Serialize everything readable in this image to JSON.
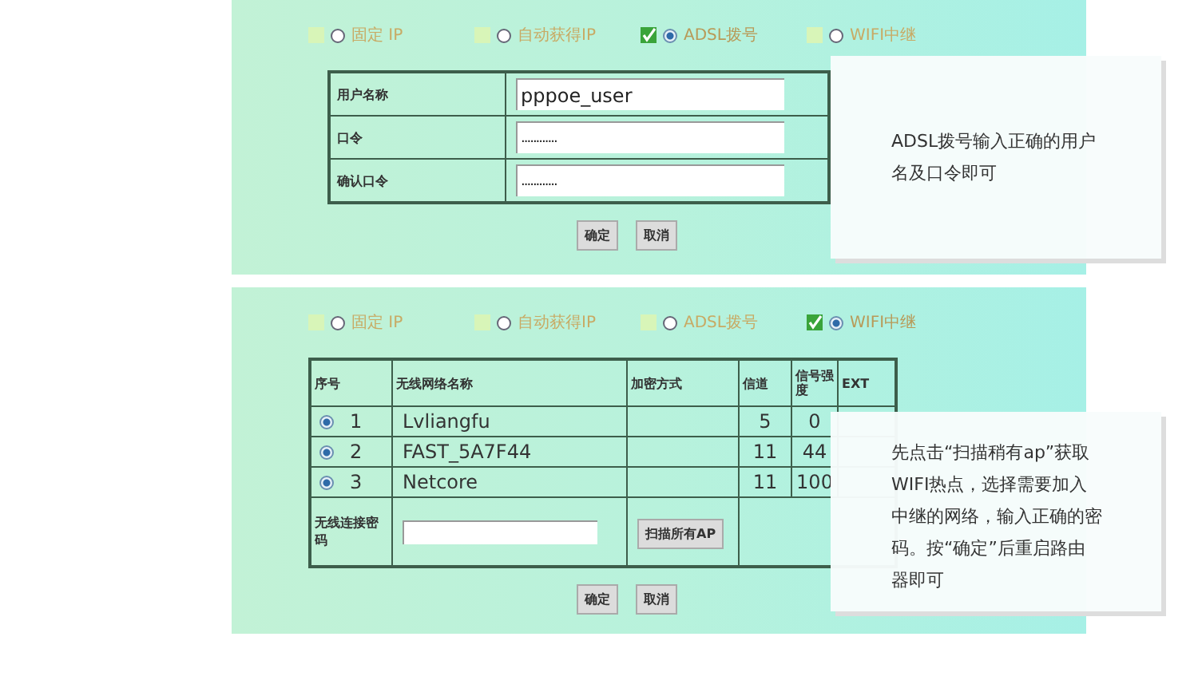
{
  "panels": [
    {
      "kind": "adsl",
      "modes": [
        {
          "label": "固定 IP",
          "selected": false
        },
        {
          "label": "自动获得IP",
          "selected": false
        },
        {
          "label": "ADSL拨号",
          "selected": true
        },
        {
          "label": "WIFI中继",
          "selected": false
        }
      ],
      "fields": [
        {
          "label": "用户名称",
          "value": "pppoe_user",
          "kind": "text"
        },
        {
          "label": "口令",
          "value": "............",
          "kind": "password"
        },
        {
          "label": "确认口令",
          "value": "............",
          "kind": "password"
        }
      ],
      "buttons": [
        "确定",
        "取消"
      ],
      "note": "ADSL拨号输入正确的用户名及口令即可"
    },
    {
      "kind": "wifi",
      "modes": [
        {
          "label": "固定 IP",
          "selected": false
        },
        {
          "label": "自动获得IP",
          "selected": false
        },
        {
          "label": "ADSL拨号",
          "selected": false
        },
        {
          "label": "WIFI中继",
          "selected": true
        }
      ],
      "table": {
        "columns": [
          "序号",
          "无线网络名称",
          "加密方式",
          "信道",
          "信号强度",
          "EXT"
        ],
        "rows": [
          {
            "index": "1",
            "ssid": "Lvliangfu",
            "channel": "5",
            "signal": "0",
            "selected": true
          },
          {
            "index": "2",
            "ssid": "FAST_5A7F44",
            "channel": "11",
            "signal": "44",
            "selected": true
          },
          {
            "index": "3",
            "ssid": "Netcore",
            "channel": "11",
            "signal": "100",
            "selected": true
          }
        ],
        "password_label": "无线连接密码",
        "scan_button": "扫描所有AP"
      },
      "buttons": [
        "确定",
        "取消"
      ],
      "note": "先点击“扫描稍有ap”获取WIFI热点，选择需要加入中继的网络，输入正确的密码。按“确定”后重启路由器即可"
    }
  ]
}
